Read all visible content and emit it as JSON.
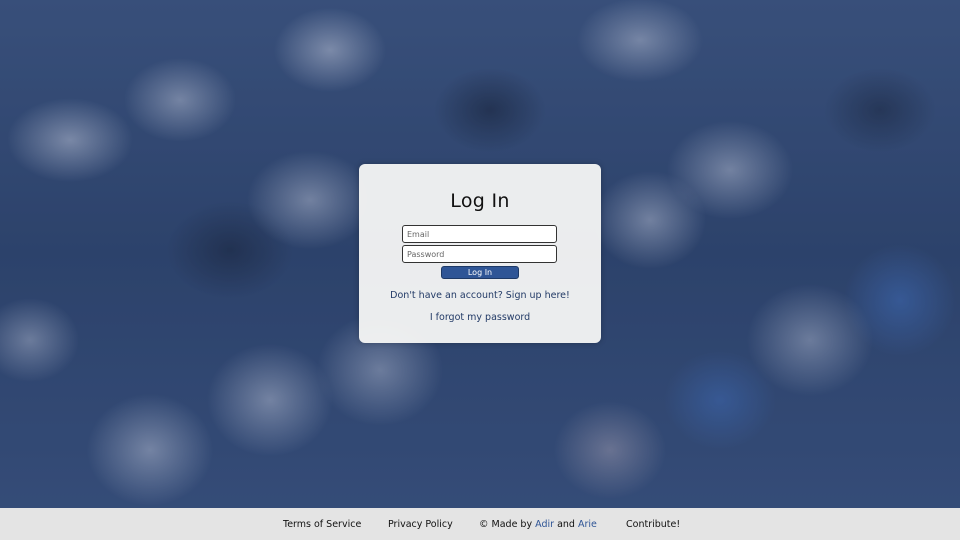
{
  "login": {
    "title": "Log In",
    "email_placeholder": "Email",
    "password_placeholder": "Password",
    "submit_label": "Log In",
    "signup_link": "Don't have an account? Sign up here!",
    "forgot_link": "I forgot my password"
  },
  "footer": {
    "terms": "Terms of Service",
    "privacy": "Privacy Policy",
    "made_by_prefix": "© Made by",
    "author1": "Adir",
    "and": "and",
    "author2": "Arie",
    "contribute": "Contribute!"
  },
  "colors": {
    "accent": "#2f5596",
    "footer_bg": "#e4e4e4"
  }
}
